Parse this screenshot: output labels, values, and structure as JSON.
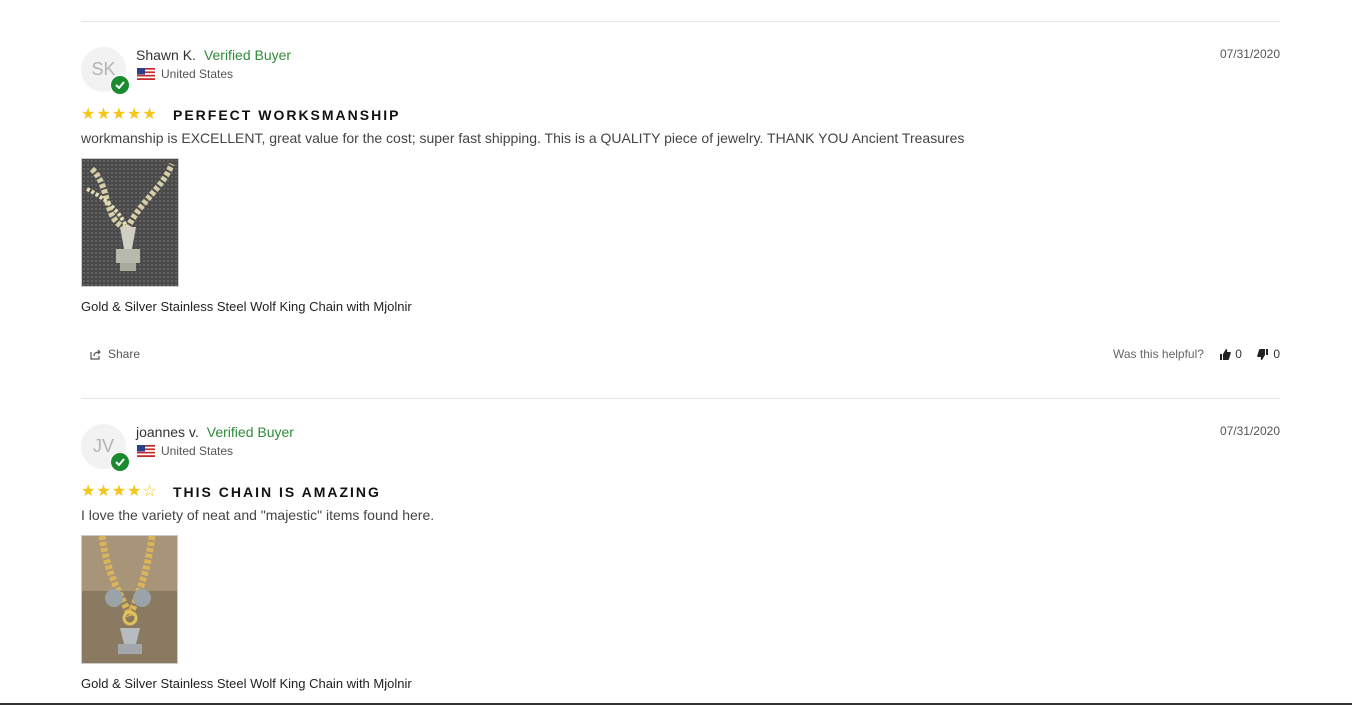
{
  "reviews": [
    {
      "initials": "SK",
      "name": "Shawn K.",
      "verified": "Verified Buyer",
      "location": "United States",
      "date": "07/31/2020",
      "rating": 5,
      "stars": "★★★★★",
      "title": "PERFECT WORKSMANSHIP",
      "body": "workmanship is EXCELLENT, great value for the cost; super fast shipping. This is a QUALITY piece of jewelry. THANK YOU Ancient Treasures",
      "product": "Gold & Silver Stainless Steel Wolf King Chain with Mjolnir",
      "share_label": "Share",
      "helpful_label": "Was this helpful?",
      "up_count": "0",
      "down_count": "0"
    },
    {
      "initials": "JV",
      "name": "joannes v.",
      "verified": "Verified Buyer",
      "location": "United States",
      "date": "07/31/2020",
      "rating": 4,
      "stars": "★★★★☆",
      "title": "THIS CHAIN IS AMAZING",
      "body": "I love the variety of neat and \"majestic\" items found here.",
      "product": "Gold & Silver Stainless Steel Wolf King Chain with Mjolnir"
    }
  ],
  "colors": {
    "star": "#f5c518",
    "verified": "#2e8b3a",
    "badge": "#1a8b2e"
  }
}
